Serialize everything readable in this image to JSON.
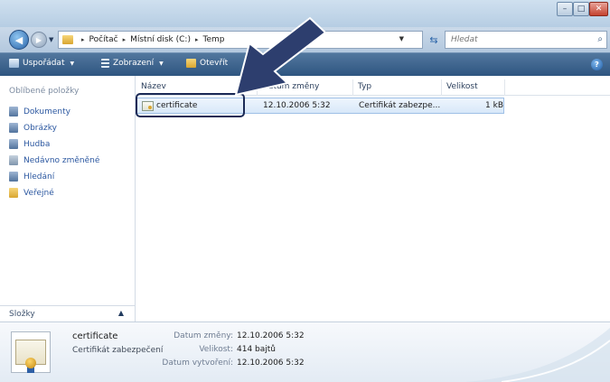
{
  "window": {
    "controls": {
      "minimize": "–",
      "maximize": "□",
      "close": "✕"
    }
  },
  "address": {
    "crumbs": [
      "Počítač",
      "Místní disk (C:)",
      "Temp"
    ],
    "separator": "▸",
    "search_placeholder": "Hledat"
  },
  "toolbar": {
    "organize": "Uspořádat",
    "views": "Zobrazení",
    "open": "Otevřít",
    "dropdown": "▼",
    "help": "?"
  },
  "nav": {
    "favorites_title": "Oblíbené položky",
    "items": [
      "Dokumenty",
      "Obrázky",
      "Hudba",
      "Nedávno změněné",
      "Hledání",
      "Veřejné"
    ],
    "folders_label": "Složky",
    "folders_chevron": "▲"
  },
  "table": {
    "headers": [
      "Název",
      "Datum změny",
      "Typ",
      "Velikost"
    ],
    "rows": [
      {
        "name": "certificate",
        "date": "12.10.2006 5:32",
        "type": "Certifikát zabezpe...",
        "size": "1 kB"
      }
    ]
  },
  "details": {
    "name": "certificate",
    "type": "Certifikát zabezpečení",
    "modified_label": "Datum změny:",
    "modified_value": "12.10.2006 5:32",
    "size_label": "Velikost:",
    "size_value": "414 bajtů",
    "created_label": "Datum vytvoření:",
    "created_value": "12.10.2006 5:32"
  },
  "colors": {
    "toolbar": "#2e5580",
    "selection": "#d8e8f9",
    "annotation": "#1b2a56"
  },
  "icons": {
    "back": "back-arrow-icon",
    "forward": "forward-arrow-icon",
    "refresh": "refresh-icon",
    "search": "search-icon",
    "certificate": "certificate-icon"
  }
}
